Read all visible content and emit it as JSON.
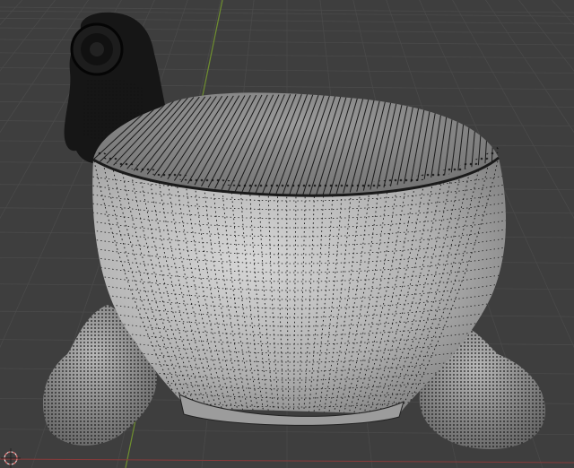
{
  "viewport": {
    "background": "#3e3e3e",
    "grid_color": "#4a4a4a",
    "y_axis_color": "#6f8f2f",
    "x_axis_color": "#8a3a3a"
  },
  "objects": [
    {
      "name": "bowl",
      "mode": "wireframe-overlay",
      "surface": "#b9b9b9",
      "wire": "#111111"
    },
    {
      "name": "minion-figure",
      "surface": "#161616"
    },
    {
      "name": "left-foot",
      "surface": "#9a9a9a",
      "wire": "#0d0d0d"
    },
    {
      "name": "right-foot",
      "surface": "#9a9a9a",
      "wire": "#0d0d0d"
    }
  ],
  "gizmo": {
    "icon": "3d-cursor-icon",
    "color": "#d46a6a"
  }
}
